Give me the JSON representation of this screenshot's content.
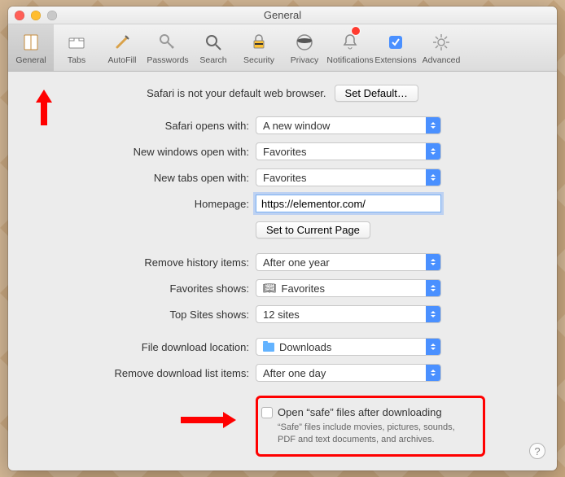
{
  "window": {
    "title": "General"
  },
  "toolbar": {
    "items": [
      {
        "label": "General",
        "icon": "general",
        "selected": true
      },
      {
        "label": "Tabs",
        "icon": "tabs",
        "selected": false
      },
      {
        "label": "AutoFill",
        "icon": "autofill",
        "selected": false
      },
      {
        "label": "Passwords",
        "icon": "passwords",
        "selected": false
      },
      {
        "label": "Search",
        "icon": "search",
        "selected": false
      },
      {
        "label": "Security",
        "icon": "security",
        "selected": false
      },
      {
        "label": "Privacy",
        "icon": "privacy",
        "selected": false
      },
      {
        "label": "Notifications",
        "icon": "notifications",
        "selected": false,
        "badge": true
      },
      {
        "label": "Extensions",
        "icon": "extensions",
        "selected": false
      },
      {
        "label": "Advanced",
        "icon": "advanced",
        "selected": false
      }
    ]
  },
  "default_browser": {
    "text": "Safari is not your default web browser.",
    "button": "Set Default…"
  },
  "fields": {
    "opens_with": {
      "label": "Safari opens with:",
      "value": "A new window"
    },
    "new_windows": {
      "label": "New windows open with:",
      "value": "Favorites"
    },
    "new_tabs": {
      "label": "New tabs open with:",
      "value": "Favorites"
    },
    "homepage": {
      "label": "Homepage:",
      "value": "https://elementor.com/"
    },
    "set_current": {
      "button": "Set to Current Page"
    },
    "remove_history": {
      "label": "Remove history items:",
      "value": "After one year"
    },
    "favorites_shows": {
      "label": "Favorites shows:",
      "value": "Favorites",
      "icon": "book"
    },
    "top_sites": {
      "label": "Top Sites shows:",
      "value": "12 sites"
    },
    "download_location": {
      "label": "File download location:",
      "value": "Downloads",
      "icon": "folder"
    },
    "remove_downloads": {
      "label": "Remove download list items:",
      "value": "After one day"
    }
  },
  "safe_files": {
    "checked": false,
    "label": "Open “safe” files after downloading",
    "description": "“Safe” files include movies, pictures, sounds, PDF and text documents, and archives."
  },
  "help": "?"
}
